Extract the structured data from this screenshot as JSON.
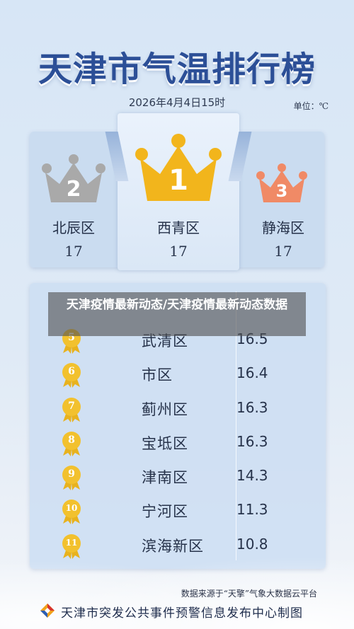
{
  "title": "天津市气温排行榜",
  "date": "2026年4月4日15时",
  "unit": "单位：℃",
  "top3": [
    {
      "rank": "2",
      "name": "北辰区",
      "value": "17"
    },
    {
      "rank": "1",
      "name": "西青区",
      "value": "17"
    },
    {
      "rank": "3",
      "name": "静海区",
      "value": "17"
    }
  ],
  "colors": {
    "silver": "#a9a9a9",
    "gold": "#f2b51c",
    "bronze": "#f08a66",
    "title": "#2c4f97"
  },
  "rows": [
    {
      "rank": "5",
      "name": "武清区",
      "value": "16.5"
    },
    {
      "rank": "6",
      "name": "市区",
      "value": "16.4"
    },
    {
      "rank": "7",
      "name": "蓟州区",
      "value": "16.3"
    },
    {
      "rank": "8",
      "name": "宝坻区",
      "value": "16.3"
    },
    {
      "rank": "9",
      "name": "津南区",
      "value": "14.3"
    },
    {
      "rank": "10",
      "name": "宁河区",
      "value": "11.3"
    },
    {
      "rank": "11",
      "name": "滨海新区",
      "value": "10.8"
    }
  ],
  "overlay_caption": "天津疫情最新动态/天津疫情最新动态数据",
  "source": "数据来源于“天擎”气象大数据云平台",
  "footer": "天津市突发公共事件预警信息发布中心制图"
}
